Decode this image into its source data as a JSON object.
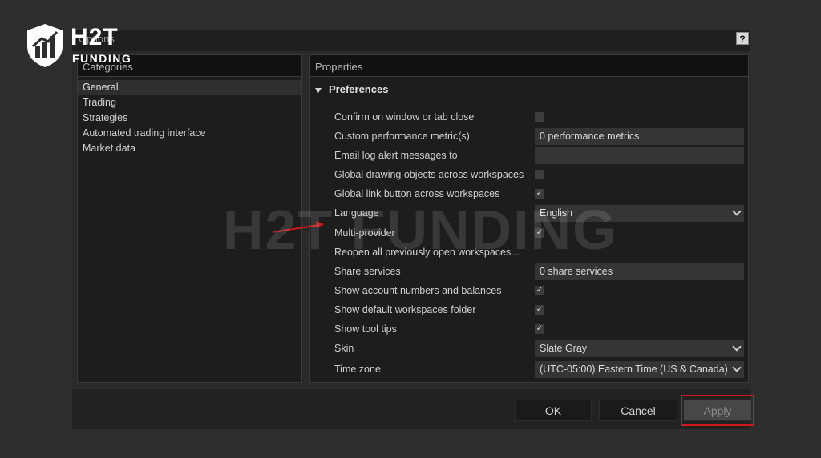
{
  "window": {
    "title": "Options",
    "help_label": "?"
  },
  "categories": {
    "header": "Categories",
    "items": [
      {
        "label": "General",
        "selected": true
      },
      {
        "label": "Trading",
        "selected": false
      },
      {
        "label": "Strategies",
        "selected": false
      },
      {
        "label": "Automated trading interface",
        "selected": false
      },
      {
        "label": "Market data",
        "selected": false
      }
    ]
  },
  "properties": {
    "header": "Properties",
    "section": "Preferences",
    "rows": [
      {
        "label": "Confirm on window or tab close",
        "type": "checkbox",
        "checked": false
      },
      {
        "label": "Custom performance metric(s)",
        "type": "text",
        "value": "0 performance metrics"
      },
      {
        "label": "Email log alert messages to",
        "type": "text",
        "value": ""
      },
      {
        "label": "Global drawing objects across workspaces",
        "type": "checkbox",
        "checked": false
      },
      {
        "label": "Global link button across workspaces",
        "type": "checkbox",
        "checked": true
      },
      {
        "label": "Language",
        "type": "select",
        "value": "English"
      },
      {
        "label": "Multi-provider",
        "type": "checkbox",
        "checked": true
      },
      {
        "label": "Reopen all previously open workspaces...",
        "type": "none"
      },
      {
        "label": "Share services",
        "type": "text",
        "value": "0 share services"
      },
      {
        "label": "Show account numbers and balances",
        "type": "checkbox",
        "checked": true
      },
      {
        "label": "Show default workspaces folder",
        "type": "checkbox",
        "checked": true
      },
      {
        "label": "Show tool tips",
        "type": "checkbox",
        "checked": true
      },
      {
        "label": "Skin",
        "type": "select",
        "value": "Slate Gray"
      },
      {
        "label": "Time zone",
        "type": "select",
        "value": "(UTC-05:00) Eastern Time (US & Canada)"
      }
    ]
  },
  "buttons": {
    "ok": "OK",
    "cancel": "Cancel",
    "apply": "Apply"
  },
  "watermark": "H2T FUNDING",
  "logo": {
    "line1": "H2T",
    "line2": "FUNDING"
  },
  "colors": {
    "highlight": "#d0181c",
    "arrow": "#d0181c",
    "background": "#2e2e2e",
    "panel": "#1d1d1d"
  }
}
